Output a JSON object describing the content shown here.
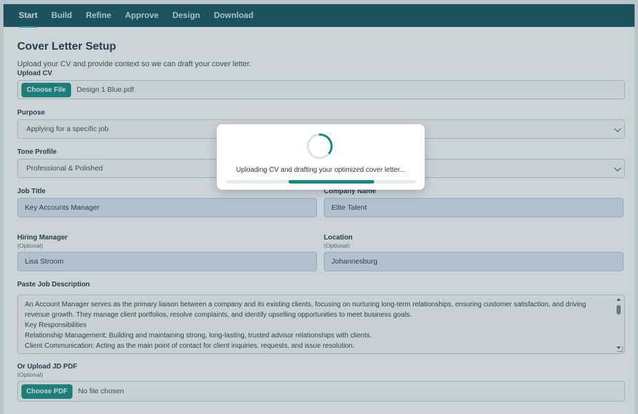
{
  "nav": {
    "tabs": [
      "Start",
      "Build",
      "Refine",
      "Approve",
      "Design",
      "Download"
    ],
    "active": "Start"
  },
  "page": {
    "title": "Cover Letter Setup",
    "subtitle": "Upload your CV and provide context so we can draft your cover letter."
  },
  "upload_cv": {
    "label": "Upload CV",
    "button": "Choose File",
    "filename": "Design 1 Blue.pdf"
  },
  "purpose": {
    "label": "Purpose",
    "value": "Applying for a specific job"
  },
  "tone": {
    "label": "Tone Profile",
    "value": "Professional & Polished"
  },
  "job_title": {
    "label": "Job Title",
    "value": "Key Accounts Manager"
  },
  "company": {
    "label": "Company Name",
    "value": "Elite Talent"
  },
  "hiring_manager": {
    "label": "Hiring Manager",
    "optional": "(Optional)",
    "value": "Lisa Stroom"
  },
  "location": {
    "label": "Location",
    "optional": "(Optional)",
    "value": "Johannesburg"
  },
  "job_description": {
    "label": "Paste Job Description",
    "lines": [
      "An Account Manager serves as the primary liaison between a company and its existing clients, focusing on nurturing long-term relationships, ensuring customer satisfaction, and driving",
      "revenue growth. They manage client portfolios, resolve complaints, and identify upselling opportunities to meet business goals.",
      "Key Responsibilities",
      "Relationship Management: Building and maintaining strong, long-lasting, trusted advisor relationships with clients.",
      "Client Communication: Acting as the main point of contact for client inquiries, requests, and issue resolution."
    ]
  },
  "upload_jd": {
    "label": "Or Upload JD PDF",
    "optional": "(Optional)",
    "button": "Choose PDF",
    "filename": "No file chosen"
  },
  "modal": {
    "message": "Uploading CV and drafting your optimized cover letter...",
    "progress_start": 0.33,
    "progress_end": 0.78
  },
  "colors": {
    "nav": "#0f4c58",
    "accent": "#148a7d",
    "input_blue": "#dde7f3"
  },
  "icons": {
    "select": "chevron-down-icon",
    "spinner": "loading-spinner-icon"
  }
}
